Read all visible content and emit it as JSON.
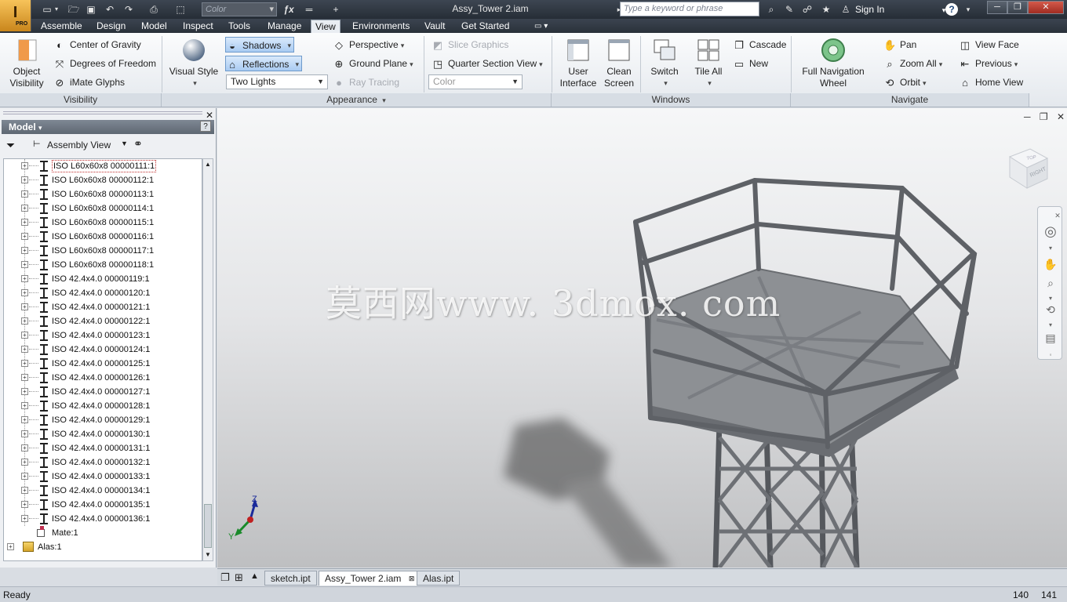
{
  "app": {
    "badge": "PRO",
    "logo_letter": "I"
  },
  "title_bar": {
    "document_title": "Assy_Tower 2.iam",
    "color_selector": "Color",
    "search_placeholder": "Type a keyword or phrase",
    "sign_in": "Sign In",
    "help": "?"
  },
  "tabs": [
    {
      "label": "Assemble"
    },
    {
      "label": "Design"
    },
    {
      "label": "Model"
    },
    {
      "label": "Inspect"
    },
    {
      "label": "Tools"
    },
    {
      "label": "Manage"
    },
    {
      "label": "View"
    },
    {
      "label": "Environments"
    },
    {
      "label": "Vault"
    },
    {
      "label": "Get Started"
    }
  ],
  "active_tab": "View",
  "ribbon": {
    "visibility": {
      "panel_label": "Visibility",
      "object_visibility": [
        "Object",
        "Visibility"
      ],
      "center_of_gravity": "Center of Gravity",
      "degrees_of_freedom": "Degrees of Freedom",
      "imate_glyphs": "iMate Glyphs"
    },
    "appearance": {
      "panel_label": "Appearance",
      "visual_style": "Visual Style",
      "shadows": "Shadows",
      "reflections": "Reflections",
      "lighting": "Two Lights",
      "perspective": "Perspective",
      "ground_plane": "Ground Plane",
      "ray_tracing": "Ray Tracing",
      "slice_graphics": "Slice Graphics",
      "quarter_section_view": "Quarter Section View",
      "color": "Color"
    },
    "windows": {
      "panel_label": "Windows",
      "user_interface": [
        "User",
        "Interface"
      ],
      "clean_screen": [
        "Clean",
        "Screen"
      ],
      "switch": "Switch",
      "tile_all": "Tile All",
      "cascade": "Cascade",
      "new": "New"
    },
    "navigate": {
      "panel_label": "Navigate",
      "full_navigation_wheel": [
        "Full Navigation",
        "Wheel"
      ],
      "pan": "Pan",
      "zoom_all": "Zoom All",
      "orbit": "Orbit",
      "view_face": "View Face",
      "previous": "Previous",
      "home_view": "Home View"
    }
  },
  "browser": {
    "header": "Model",
    "view_selector": "Assembly View",
    "items": [
      {
        "label": "ISO L60x60x8 00000111:1",
        "selected": true
      },
      {
        "label": "ISO L60x60x8 00000112:1"
      },
      {
        "label": "ISO L60x60x8 00000113:1"
      },
      {
        "label": "ISO L60x60x8 00000114:1"
      },
      {
        "label": "ISO L60x60x8 00000115:1"
      },
      {
        "label": "ISO L60x60x8 00000116:1"
      },
      {
        "label": "ISO L60x60x8 00000117:1"
      },
      {
        "label": "ISO L60x60x8 00000118:1"
      },
      {
        "label": "ISO 42.4x4.0 00000119:1"
      },
      {
        "label": "ISO 42.4x4.0 00000120:1"
      },
      {
        "label": "ISO 42.4x4.0 00000121:1"
      },
      {
        "label": "ISO 42.4x4.0 00000122:1"
      },
      {
        "label": "ISO 42.4x4.0 00000123:1"
      },
      {
        "label": "ISO 42.4x4.0 00000124:1"
      },
      {
        "label": "ISO 42.4x4.0 00000125:1"
      },
      {
        "label": "ISO 42.4x4.0 00000126:1"
      },
      {
        "label": "ISO 42.4x4.0 00000127:1"
      },
      {
        "label": "ISO 42.4x4.0 00000128:1"
      },
      {
        "label": "ISO 42.4x4.0 00000129:1"
      },
      {
        "label": "ISO 42.4x4.0 00000130:1"
      },
      {
        "label": "ISO 42.4x4.0 00000131:1"
      },
      {
        "label": "ISO 42.4x4.0 00000132:1"
      },
      {
        "label": "ISO 42.4x4.0 00000133:1"
      },
      {
        "label": "ISO 42.4x4.0 00000134:1"
      },
      {
        "label": "ISO 42.4x4.0 00000135:1"
      },
      {
        "label": "ISO 42.4x4.0 00000136:1"
      }
    ],
    "mate": "Mate:1",
    "alas": "Alas:1"
  },
  "viewport": {
    "watermark": "莫西网www. 3dmox. com",
    "viewcube_face": "RIGHT",
    "viewcube_top": "TOP",
    "triad": {
      "z": "Z",
      "y": "Y"
    }
  },
  "doc_tabs": [
    {
      "label": "sketch.ipt"
    },
    {
      "label": "Assy_Tower 2.iam",
      "active": true
    },
    {
      "label": "Alas.ipt"
    }
  ],
  "status": {
    "text": "Ready",
    "num1": "140",
    "num2": "141"
  },
  "colors": {
    "title_bar": "#2e3640",
    "ribbon": "#eef1f4",
    "toggle_active": "#b9d6f6",
    "viewport_top": "#f6f7f8",
    "viewport_bottom": "#bebfc1"
  }
}
